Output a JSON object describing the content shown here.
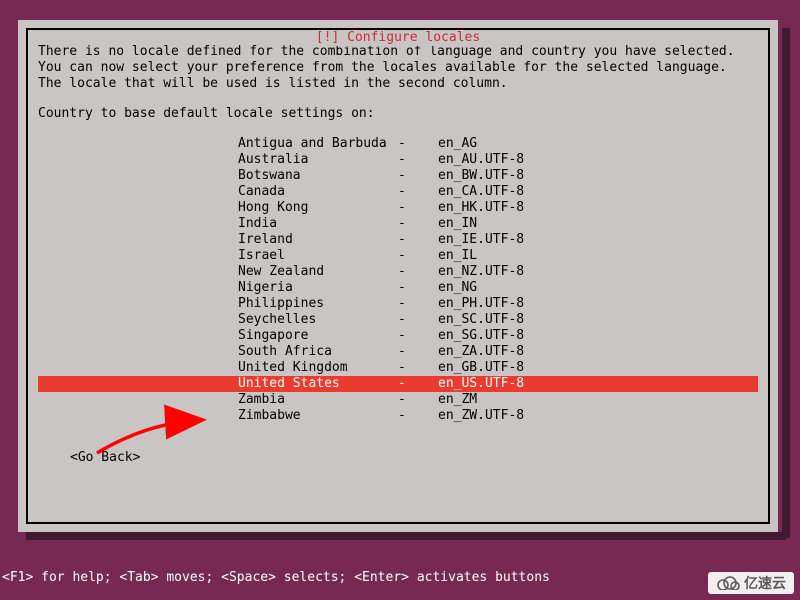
{
  "dialog": {
    "title": "[!] Configure locales",
    "body": "There is no locale defined for the combination of language and country you have selected.\nYou can now select your preference from the locales available for the selected language.\nThe locale that will be used is listed in the second column.",
    "prompt": "Country to base default locale settings on:"
  },
  "locales": [
    {
      "country": "Antigua and Barbuda",
      "code": "en_AG",
      "selected": false
    },
    {
      "country": "Australia",
      "code": "en_AU.UTF-8",
      "selected": false
    },
    {
      "country": "Botswana",
      "code": "en_BW.UTF-8",
      "selected": false
    },
    {
      "country": "Canada",
      "code": "en_CA.UTF-8",
      "selected": false
    },
    {
      "country": "Hong Kong",
      "code": "en_HK.UTF-8",
      "selected": false
    },
    {
      "country": "India",
      "code": "en_IN",
      "selected": false
    },
    {
      "country": "Ireland",
      "code": "en_IE.UTF-8",
      "selected": false
    },
    {
      "country": "Israel",
      "code": "en_IL",
      "selected": false
    },
    {
      "country": "New Zealand",
      "code": "en_NZ.UTF-8",
      "selected": false
    },
    {
      "country": "Nigeria",
      "code": "en_NG",
      "selected": false
    },
    {
      "country": "Philippines",
      "code": "en_PH.UTF-8",
      "selected": false
    },
    {
      "country": "Seychelles",
      "code": "en_SC.UTF-8",
      "selected": false
    },
    {
      "country": "Singapore",
      "code": "en_SG.UTF-8",
      "selected": false
    },
    {
      "country": "South Africa",
      "code": "en_ZA.UTF-8",
      "selected": false
    },
    {
      "country": "United Kingdom",
      "code": "en_GB.UTF-8",
      "selected": false
    },
    {
      "country": "United States",
      "code": "en_US.UTF-8",
      "selected": true
    },
    {
      "country": "Zambia",
      "code": "en_ZM",
      "selected": false
    },
    {
      "country": "Zimbabwe",
      "code": "en_ZW.UTF-8",
      "selected": false
    }
  ],
  "go_back": "<Go Back>",
  "help_bar": "<F1> for help; <Tab> moves; <Space> selects; <Enter> activates buttons",
  "watermark": "亿速云"
}
